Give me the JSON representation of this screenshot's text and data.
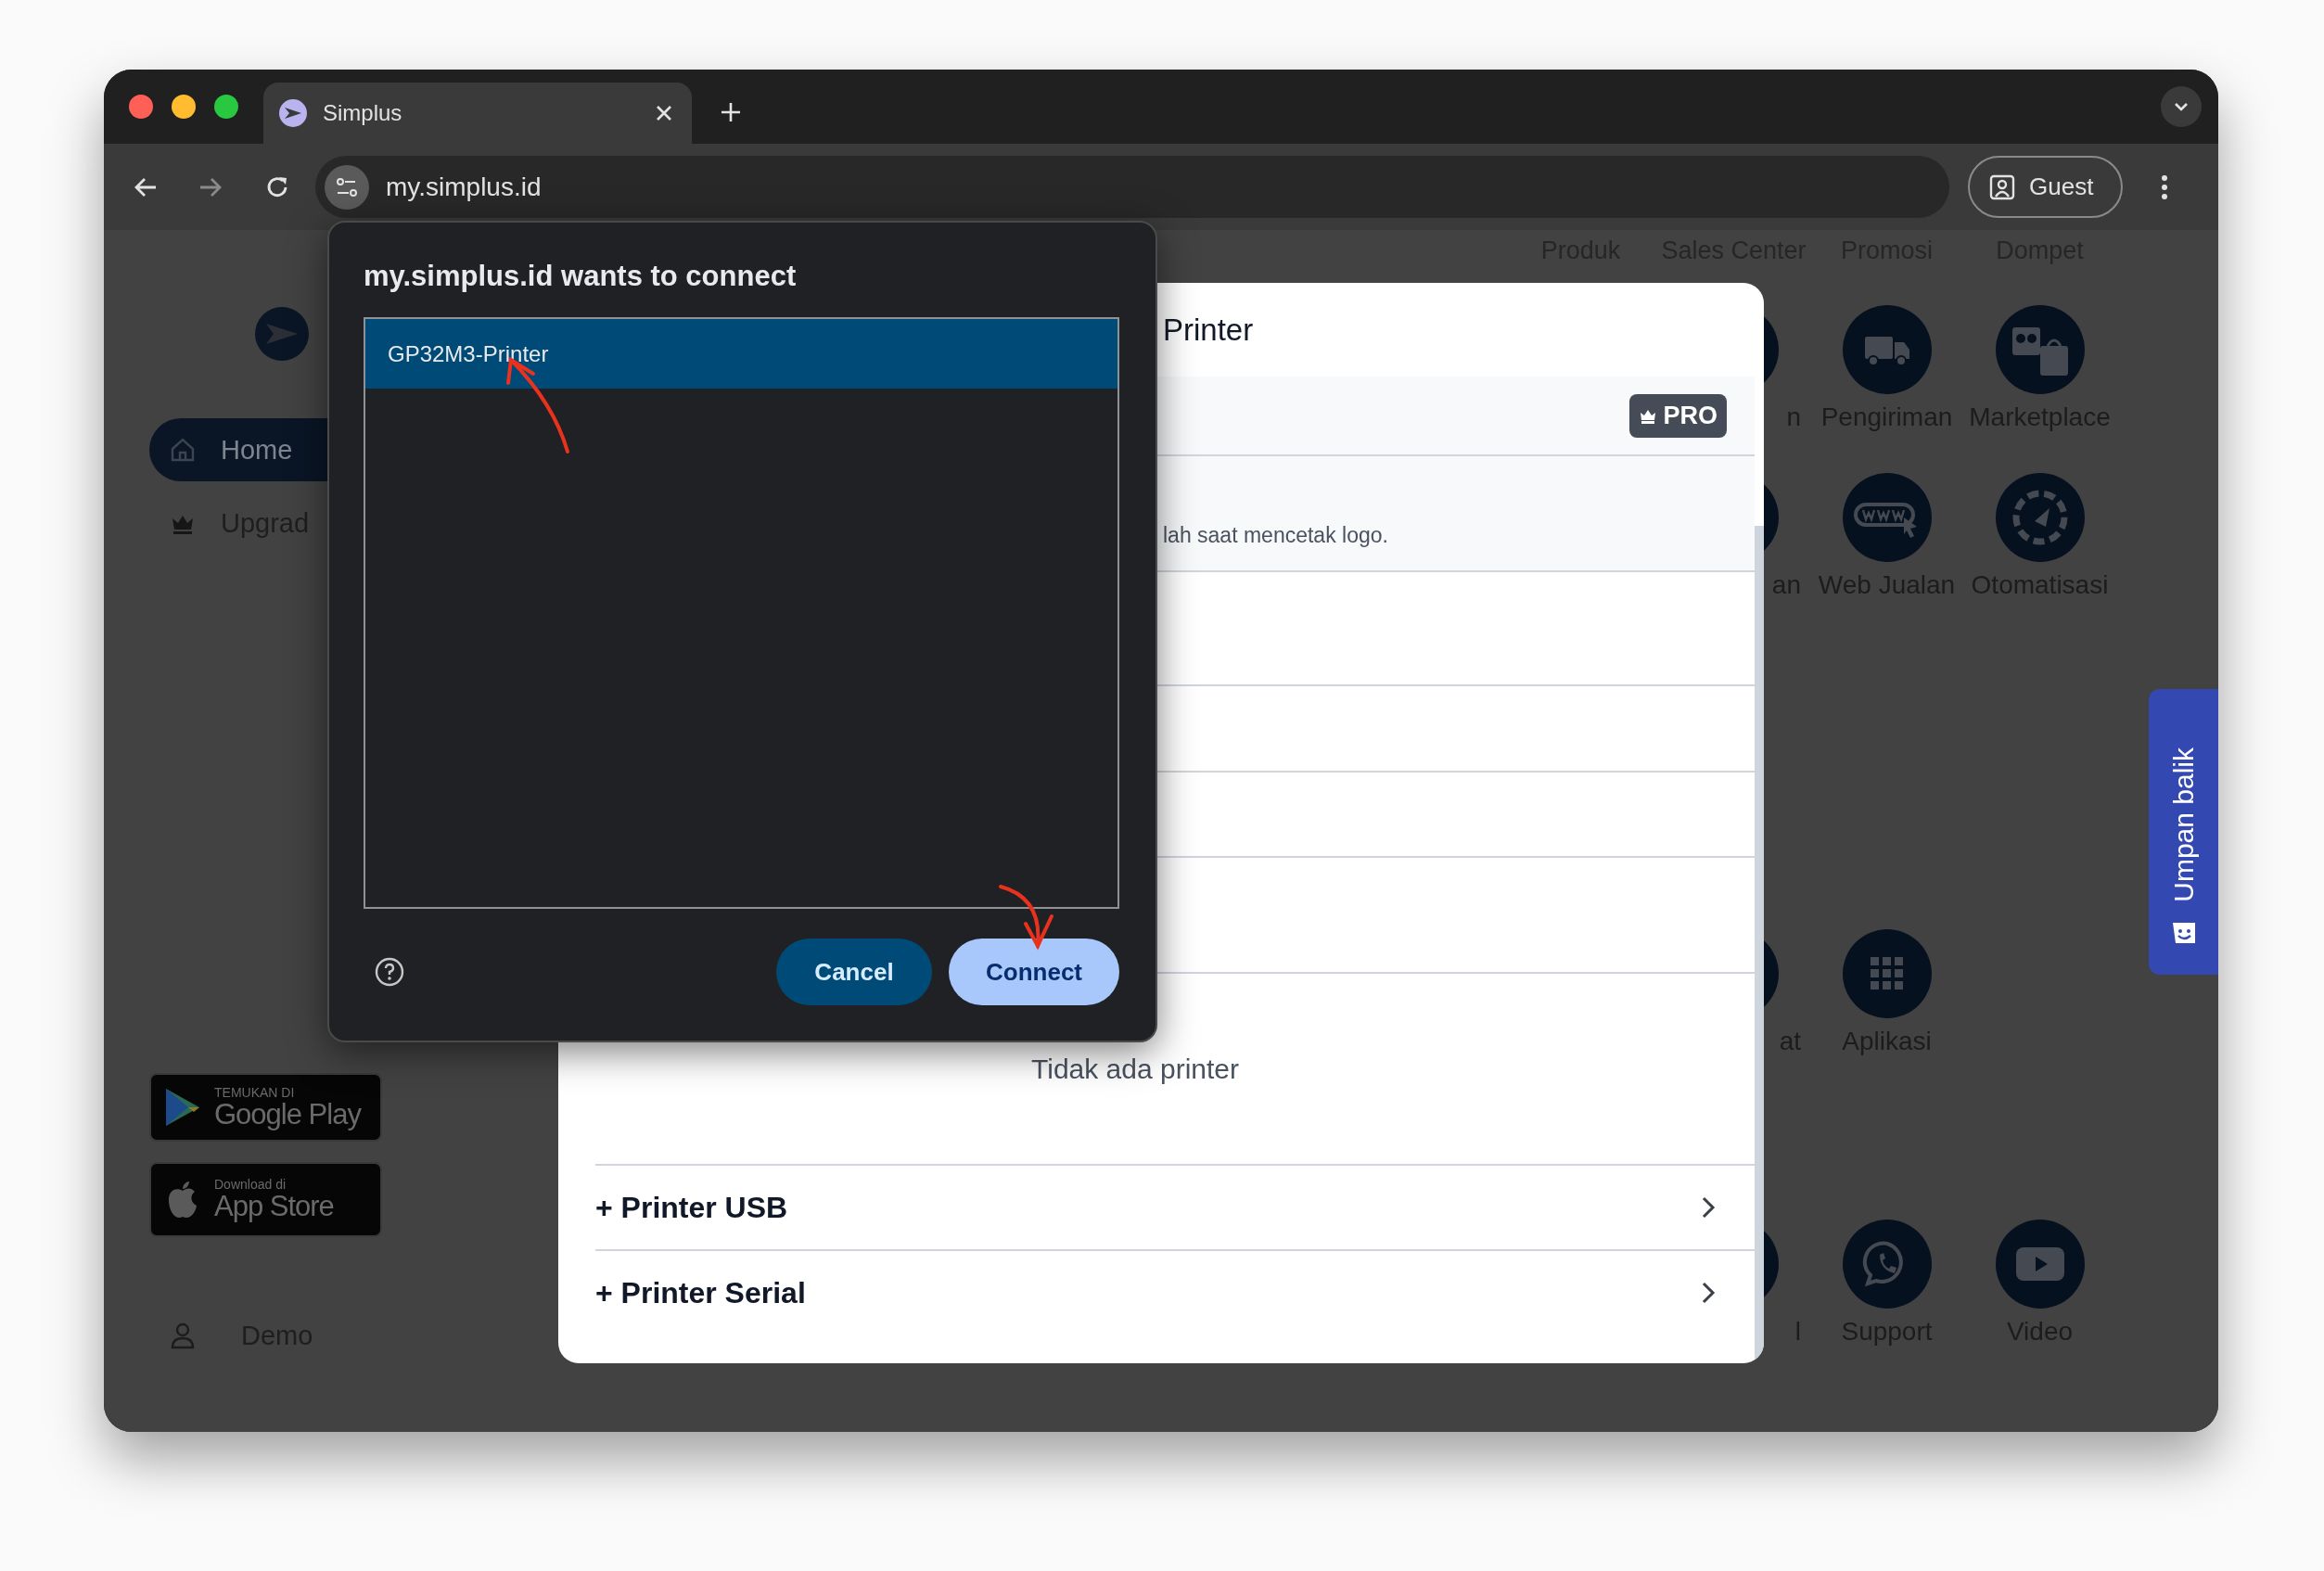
{
  "browser": {
    "tab_title": "Simplus",
    "address": "my.simplus.id",
    "profile": "Guest"
  },
  "sidebar": {
    "items": [
      {
        "label": "Home",
        "kind": "home",
        "selected": true
      },
      {
        "label": "Upgrad",
        "kind": "crown",
        "selected": false
      }
    ],
    "store_badges": [
      {
        "small": "TEMUKAN DI",
        "big": "Google Play",
        "kind": "play"
      },
      {
        "small": "Download di",
        "big": "App Store",
        "kind": "apple"
      }
    ],
    "user": "Demo"
  },
  "top_nav": [
    "Produk",
    "Sales Center",
    "Promosi",
    "Dompet"
  ],
  "apps": [
    [
      {
        "label": "n",
        "kind": "partial"
      },
      {
        "label": "Pengiriman",
        "kind": "truck"
      },
      {
        "label": "Marketplace",
        "kind": "bags"
      }
    ],
    [
      {
        "label": "an",
        "kind": "partial"
      },
      {
        "label": "Web Jualan",
        "kind": "www"
      },
      {
        "label": "Otomatisasi",
        "kind": "dial"
      }
    ],
    [
      {
        "label": "at",
        "kind": "partial"
      },
      {
        "label": "Aplikasi",
        "kind": "grid"
      }
    ],
    [
      {
        "label": "l",
        "kind": "partial"
      },
      {
        "label": "Support",
        "kind": "chat"
      },
      {
        "label": "Video",
        "kind": "video"
      }
    ]
  ],
  "feedback_tab": {
    "label": "Umpan balik"
  },
  "printer_modal": {
    "title": "Printer",
    "pro_badge": "PRO",
    "note": "lah saat mencetak logo.",
    "empty_message": "Tidak ada printer",
    "options": [
      "+ Printer USB",
      "+ Printer Serial"
    ]
  },
  "device_chooser": {
    "title": "my.simplus.id wants to connect",
    "devices": [
      {
        "name": "GP32M3-Printer",
        "selected": true
      }
    ],
    "buttons": [
      {
        "label": "Cancel",
        "kind": "secondary"
      },
      {
        "label": "Connect",
        "kind": "primary"
      }
    ]
  }
}
